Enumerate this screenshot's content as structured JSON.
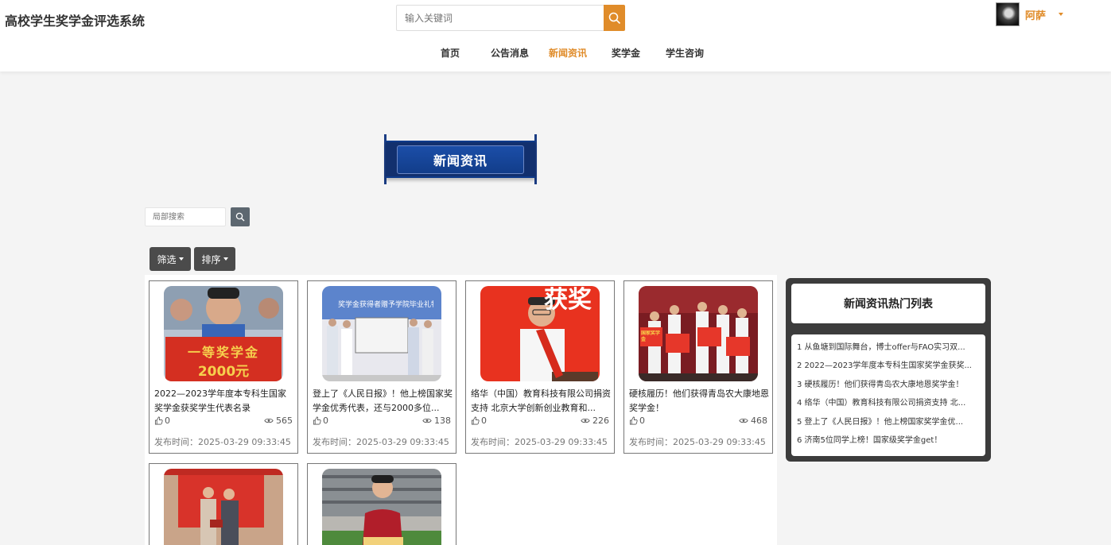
{
  "header": {
    "site_title": "高校学生奖学金评选系统",
    "search_placeholder": "输入关键词",
    "username": "阿萨"
  },
  "nav": [
    "首页",
    "公告消息",
    "新闻资讯",
    "奖学金",
    "学生咨询"
  ],
  "nav_active": "新闻资讯",
  "banner": {
    "title": "新闻资讯"
  },
  "local_search": {
    "placeholder": "局部搜索"
  },
  "filters": {
    "filter_label": "筛选",
    "sort_label": "排序"
  },
  "cards": [
    {
      "title": "2022—2023学年度本专科生国家奖学金获奖学生代表名录",
      "likes": "0",
      "views": "565",
      "time": "发布时间：2025-03-29 09:33:45"
    },
    {
      "title": "登上了《人民日报》！他上榜国家奖学金优秀代表，还与2000多位...",
      "likes": "0",
      "views": "138",
      "time": "发布时间：2025-03-29 09:33:45"
    },
    {
      "title": "络华（中国）教育科技有限公司捐资支持 北京大学创新创业教育和...",
      "likes": "0",
      "views": "226",
      "time": "发布时间：2025-03-29 09:33:45"
    },
    {
      "title": "硬核履历！他们获得青岛农大康地恩奖学金！",
      "likes": "0",
      "views": "468",
      "time": "发布时间：2025-03-29 09:33:45"
    }
  ],
  "thumb_texts": {
    "card1_banner": "一等奖学金",
    "card1_amount": "2000元",
    "card2_sign": "奖学金获得者赠予学院毕业礼物",
    "card3_big": "获奖",
    "card4_sign": "国家奖学金"
  },
  "hot": {
    "title": "新闻资讯热门列表",
    "items": [
      "1  从鱼塘到国际舞台，博士offer与FAO实习双...",
      "2  2022—2023学年度本专科生国家奖学金获奖...",
      "3  硬核履历！他们获得青岛农大康地恩奖学金！",
      "4  络华（中国）教育科技有限公司捐资支持 北...",
      "5  登上了《人民日报》！他上榜国家奖学金优...",
      "6  济南5位同学上榜！国家级奖学金get！"
    ]
  },
  "colors": {
    "accent": "#e08c2a",
    "banner_blue": "#12306e",
    "panel_dark": "#3c3c3c"
  }
}
